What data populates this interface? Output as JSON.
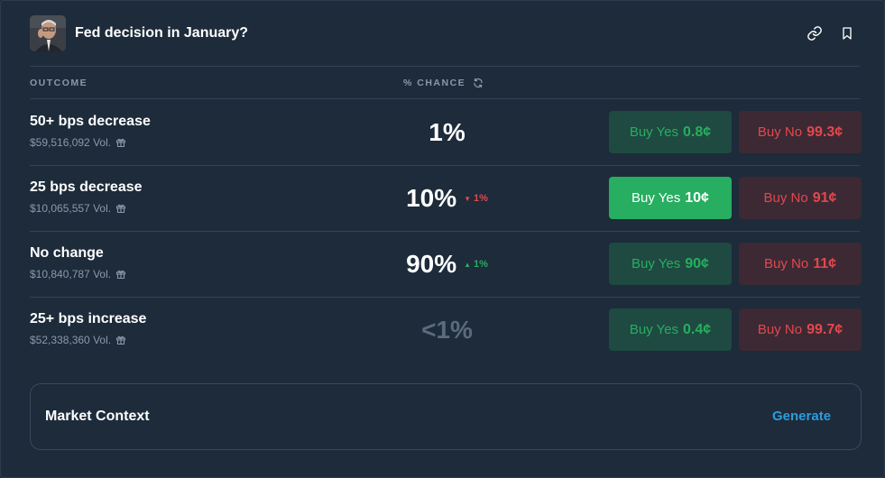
{
  "header": {
    "title": "Fed decision in January?",
    "icons": [
      "link-icon",
      "bookmark-icon"
    ]
  },
  "columns": {
    "outcome": "OUTCOME",
    "chance": "% CHANCE"
  },
  "rows": [
    {
      "name": "50+ bps decrease",
      "volume": "$59,516,092 Vol.",
      "chance": "1%",
      "chance_dim": false,
      "delta": null,
      "buy_yes_label": "Buy Yes",
      "buy_yes_price": "0.8¢",
      "buy_yes_active": false,
      "buy_no_label": "Buy No",
      "buy_no_price": "99.3¢"
    },
    {
      "name": "25 bps decrease",
      "volume": "$10,065,557 Vol.",
      "chance": "10%",
      "chance_dim": false,
      "delta": {
        "direction": "down",
        "value": "1%"
      },
      "buy_yes_label": "Buy Yes",
      "buy_yes_price": "10¢",
      "buy_yes_active": true,
      "buy_no_label": "Buy No",
      "buy_no_price": "91¢"
    },
    {
      "name": "No change",
      "volume": "$10,840,787 Vol.",
      "chance": "90%",
      "chance_dim": false,
      "delta": {
        "direction": "up",
        "value": "1%"
      },
      "buy_yes_label": "Buy Yes",
      "buy_yes_price": "90¢",
      "buy_yes_active": false,
      "buy_no_label": "Buy No",
      "buy_no_price": "11¢"
    },
    {
      "name": "25+ bps increase",
      "volume": "$52,338,360 Vol.",
      "chance": "<1%",
      "chance_dim": true,
      "delta": null,
      "buy_yes_label": "Buy Yes",
      "buy_yes_price": "0.4¢",
      "buy_yes_active": false,
      "buy_no_label": "Buy No",
      "buy_no_price": "99.7¢"
    }
  ],
  "context": {
    "label": "Market Context",
    "action": "Generate"
  },
  "colors": {
    "background": "#1d2b3a",
    "yes": "#27ae60",
    "no": "#e2484f",
    "link": "#2d9cdb"
  }
}
